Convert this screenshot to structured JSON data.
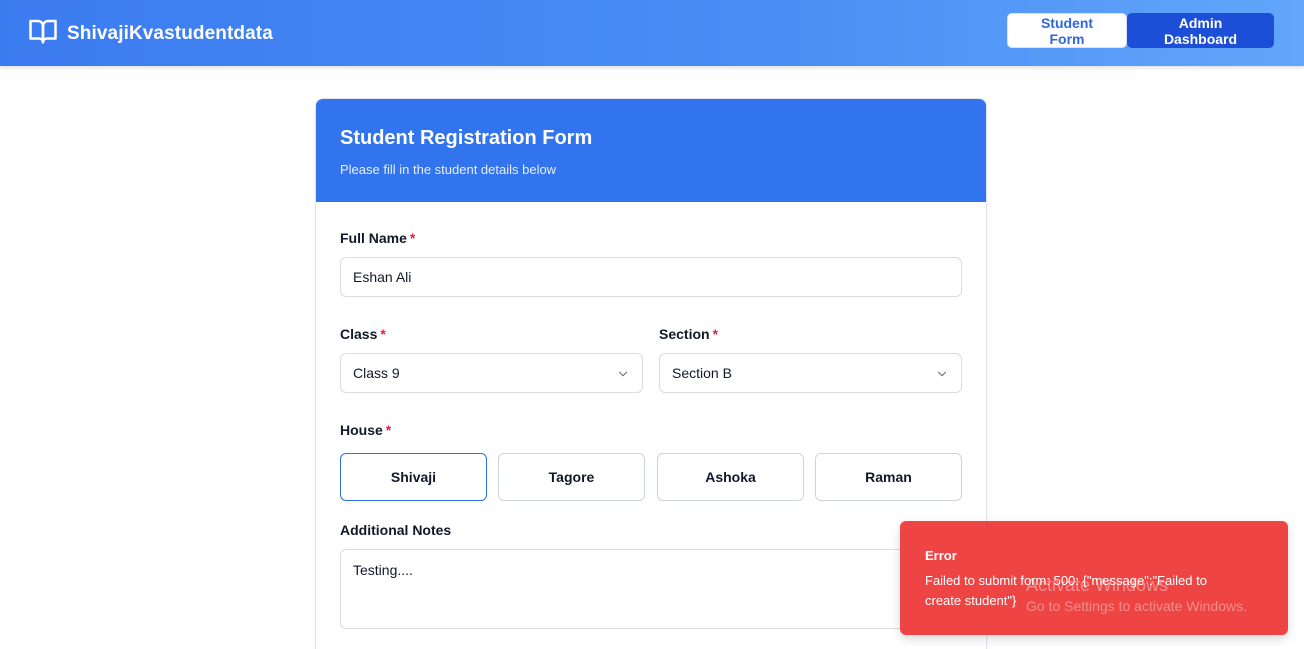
{
  "header": {
    "brand": "ShivajiKvastudentdata",
    "nav": {
      "student_form": "Student Form",
      "admin_dashboard": "Admin Dashboard"
    }
  },
  "form": {
    "title": "Student Registration Form",
    "subtitle": "Please fill in the student details below",
    "required_marker": "*",
    "full_name": {
      "label": "Full Name",
      "value": "Eshan Ali"
    },
    "class": {
      "label": "Class",
      "value": "Class 9"
    },
    "section": {
      "label": "Section",
      "value": "Section B"
    },
    "house": {
      "label": "House",
      "options": [
        "Shivaji",
        "Tagore",
        "Ashoka",
        "Raman"
      ],
      "selected": "Shivaji"
    },
    "notes": {
      "label": "Additional Notes",
      "value": "Testing...."
    }
  },
  "toast": {
    "title": "Error",
    "message": "Failed to submit form: 500: {\"message\":\"Failed to create student\"}"
  },
  "watermark": {
    "title": "Activate Windows",
    "subtitle": "Go to Settings to activate Windows."
  },
  "colors": {
    "header_gradient_start": "#3b7bf0",
    "header_gradient_end": "#62a6fb",
    "card_header": "#3273ee",
    "admin_button": "#1d4ed8",
    "toast": "#ef4444",
    "required": "#e11d48"
  },
  "icons": {
    "brand": "open-book-icon",
    "select": "chevron-down-icon"
  }
}
